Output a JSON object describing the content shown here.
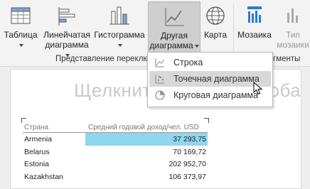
{
  "ribbon": {
    "buttons": [
      {
        "label1": "Таблица",
        "has_caret": true
      },
      {
        "label1": "Линейчатая",
        "label2": "диаграмма",
        "has_caret": true
      },
      {
        "label1": "Гистограмма",
        "has_caret": true
      },
      {
        "label1": "Другая",
        "label2": "диаграмма",
        "has_caret": true
      },
      {
        "label1": "Карта"
      },
      {
        "label1": "Мозаика"
      },
      {
        "label1": "Тип",
        "label2": "мозаики"
      }
    ],
    "group_label_left": "Представление переклю",
    "group_label_right": "гменты"
  },
  "menu": {
    "items": [
      {
        "label": "Строка",
        "icon": "line-chart-icon"
      },
      {
        "label": "Точечная диаграмма",
        "icon": "scatter-chart-icon"
      },
      {
        "label": "Круговая диаграмма",
        "icon": "pie-chart-icon"
      }
    ]
  },
  "canvas": {
    "title_left": "Щелкнит",
    "title_right": "доба"
  },
  "table": {
    "col1": "Страна",
    "col2": "Средний годовой доход/чел. USD",
    "rows": [
      {
        "country": "Armenia",
        "value": "37 293,75"
      },
      {
        "country": "Belarus",
        "value": "70 169,72"
      },
      {
        "country": "Estonia",
        "value": "202 952,70"
      },
      {
        "country": "Kazakhstan",
        "value": "106 373,97"
      }
    ]
  },
  "colors": {
    "selection": "#8fd6ef",
    "accent": "#2b7cd3"
  }
}
